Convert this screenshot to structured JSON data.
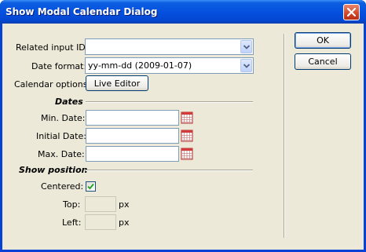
{
  "window": {
    "title": "Show Modal Calendar Dialog"
  },
  "form": {
    "related_input_label": "Related input ID:",
    "related_input_value": "",
    "date_format_label": "Date format:",
    "date_format_value": "yy-mm-dd (2009-01-07)",
    "calendar_options_label": "Calendar options:",
    "live_editor_label": "Live Editor"
  },
  "dates": {
    "section_title": "Dates",
    "min_label": "Min. Date:",
    "min_value": "",
    "initial_label": "Initial Date:",
    "initial_value": "",
    "max_label": "Max. Date:",
    "max_value": ""
  },
  "position": {
    "section_title": "Show position",
    "centered_label": "Centered:",
    "centered_checked": true,
    "top_label": "Top:",
    "top_value": "",
    "top_unit": "px",
    "left_label": "Left:",
    "left_value": "",
    "left_unit": "px"
  },
  "buttons": {
    "ok_label": "OK",
    "cancel_label": "Cancel"
  },
  "icons": {
    "close": "close-icon",
    "dropdown": "chevron-down-icon",
    "calendar": "calendar-icon",
    "check": "checkmark-icon"
  }
}
